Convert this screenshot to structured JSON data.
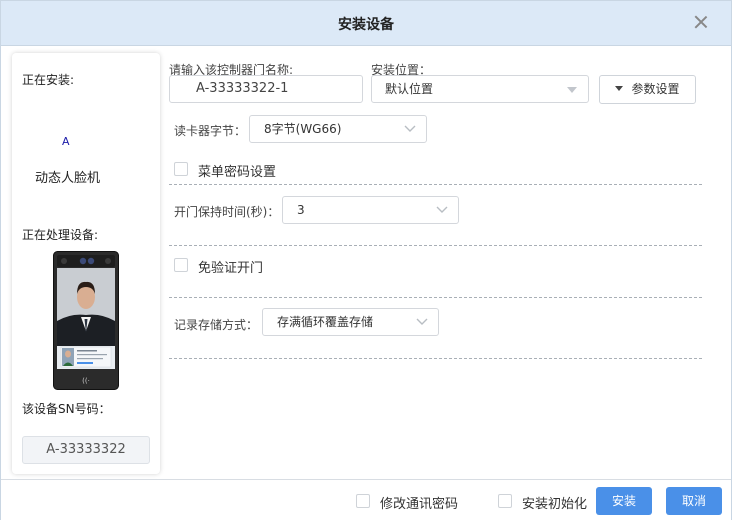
{
  "dialog": {
    "title": "安装设备"
  },
  "left_panel": {
    "installing_label": "正在安装:",
    "installing_marker": "A",
    "device_type": "动态人脸机",
    "processing_label": "正在处理设备:",
    "sn_label": "该设备SN号码：",
    "sn_value": "A-33333322"
  },
  "form": {
    "door_name_label": "请输入该控制器门名称:",
    "door_name_value": "A-33333322-1",
    "location_label": "安装位置：",
    "location_value": "默认位置",
    "param_button_label": "参数设置",
    "card_bytes_label": "读卡器字节：",
    "card_bytes_value": "8字节(WG66)",
    "menu_password_label": "菜单密码设置",
    "door_hold_label": "开门保持时间(秒)：",
    "door_hold_value": "3",
    "free_open_label": "免验证开门",
    "record_storage_label": "记录存储方式：",
    "record_storage_value": "存满循环覆盖存储"
  },
  "footer": {
    "modify_comm_password_label": "修改通讯密码",
    "install_init_label": "安装初始化",
    "install_button": "安装",
    "cancel_button": "取消"
  },
  "icons": {
    "close": "close-icon",
    "chevron": "chevron-down-icon",
    "caret": "caret-down-icon"
  },
  "colors": {
    "header_bg": "#dce9f7",
    "primary": "#4a90e8",
    "marker": "#1a1aa8"
  }
}
